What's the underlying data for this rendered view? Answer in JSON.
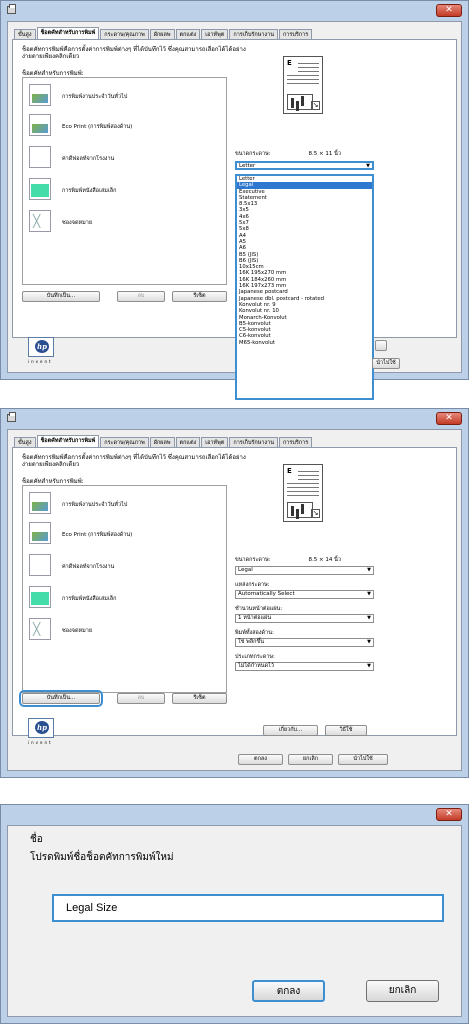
{
  "tabs": [
    "ขั้นสูง",
    "ช็อตคัทสำหรับการพิมพ์",
    "กระดาษ/คุณภาพ",
    "ผักผลพ",
    "ตกแต่ง",
    "เอาท์พุต",
    "การเก็บรักษางาน",
    "การบริการ"
  ],
  "description": "ช็อตคัทการพิมพ์คือการตั้งค่าการพิมพ์ต่างๆ ที่ได้บันทึกไว้ ซึ่งคุณสามารถเลือกได้ได้อย่างง่ายดายเพียงคลิกเดียว",
  "shortcuts_label": "ช็อตคัทสำหรับการพิมพ์:",
  "shortcuts": [
    {
      "label": "การพิมพ์งานประจำวันทั่วไป",
      "icon": "document-image-icon"
    },
    {
      "label": "Eco Print (การพิมพ์สองด้าน)",
      "icon": "duplex-document-icon"
    },
    {
      "label": "ค่าดีฟอลท์จากโรงงาน",
      "icon": "blank-page-icon"
    },
    {
      "label": "การพิมพ์หนังสือเล่มเล็ก",
      "icon": "booklet-icon"
    },
    {
      "label": "ซองจดหมาย",
      "icon": "envelope-icon"
    }
  ],
  "buttons": {
    "save_as": "บันทึกเป็น...",
    "delete": "ลบ",
    "reset": "รีเซ็ต",
    "about": "เกี่ยวกับ...",
    "help": "วิธีใช้",
    "ok": "ตกลง",
    "cancel": "ยกเลิก",
    "apply": "นำไปใช้"
  },
  "window1": {
    "paper_size_label": "ขนาดกระดาษ:",
    "paper_size_dims": "8.5 × 11 นิ้ว",
    "paper_size_selected": "Letter",
    "apply_fragment": "นำไปใช้",
    "dropdown_options": [
      "Letter",
      "Legal",
      "Executive",
      "Statement",
      "8.5x13",
      "3x5",
      "4x6",
      "5x7",
      "5x8",
      "A4",
      "A5",
      "A6",
      "B5 (JIS)",
      "B6 (JIS)",
      "10x15cm",
      "16K 195x270 mm",
      "16K 184x260 mm",
      "16K 197x273 mm",
      "Japanese postcard",
      "Japanese dbl. postcard - rotated",
      "Konvolut nr. 9",
      "Konvolut nr. 10",
      "Monarch-Konvolut",
      "B5-konvolut",
      "C5-konvolut",
      "C6-konvolut",
      "M65-konvolut"
    ],
    "highlighted_option": "Legal"
  },
  "window2": {
    "paper_size_label": "ขนาดกระดาษ:",
    "paper_size_dims": "8.5 × 14 นิ้ว",
    "paper_size_value": "Legal",
    "paper_source_label": "แหล่งกระดาษ:",
    "paper_source_value": "Automatically Select",
    "paper_type_label": "ชำนวนหน้าต่อแผ่น:",
    "paper_type_value": "1 หน้าต่อแผ่น",
    "duplex_label": "พิมพ์ทั้งสองด้าน:",
    "duplex_value": "ใช่ พลิกขึ้น",
    "orientation_label": "ประเภทกระดาษ:",
    "orientation_value": "ไม่ได้กำหนดไว้"
  },
  "dialog": {
    "title": "ชื่อ",
    "message": "โปรดพิมพ์ชื่อช็อตคัทการพิมพ์ใหม่",
    "input_value": "Legal Size",
    "ok": "ตกลง",
    "cancel": "ยกเลิก"
  },
  "logo_text": "invent",
  "colors": {
    "accent": "#3e8ed2",
    "frame": "#bcd0e8",
    "close": "#c33a25"
  }
}
